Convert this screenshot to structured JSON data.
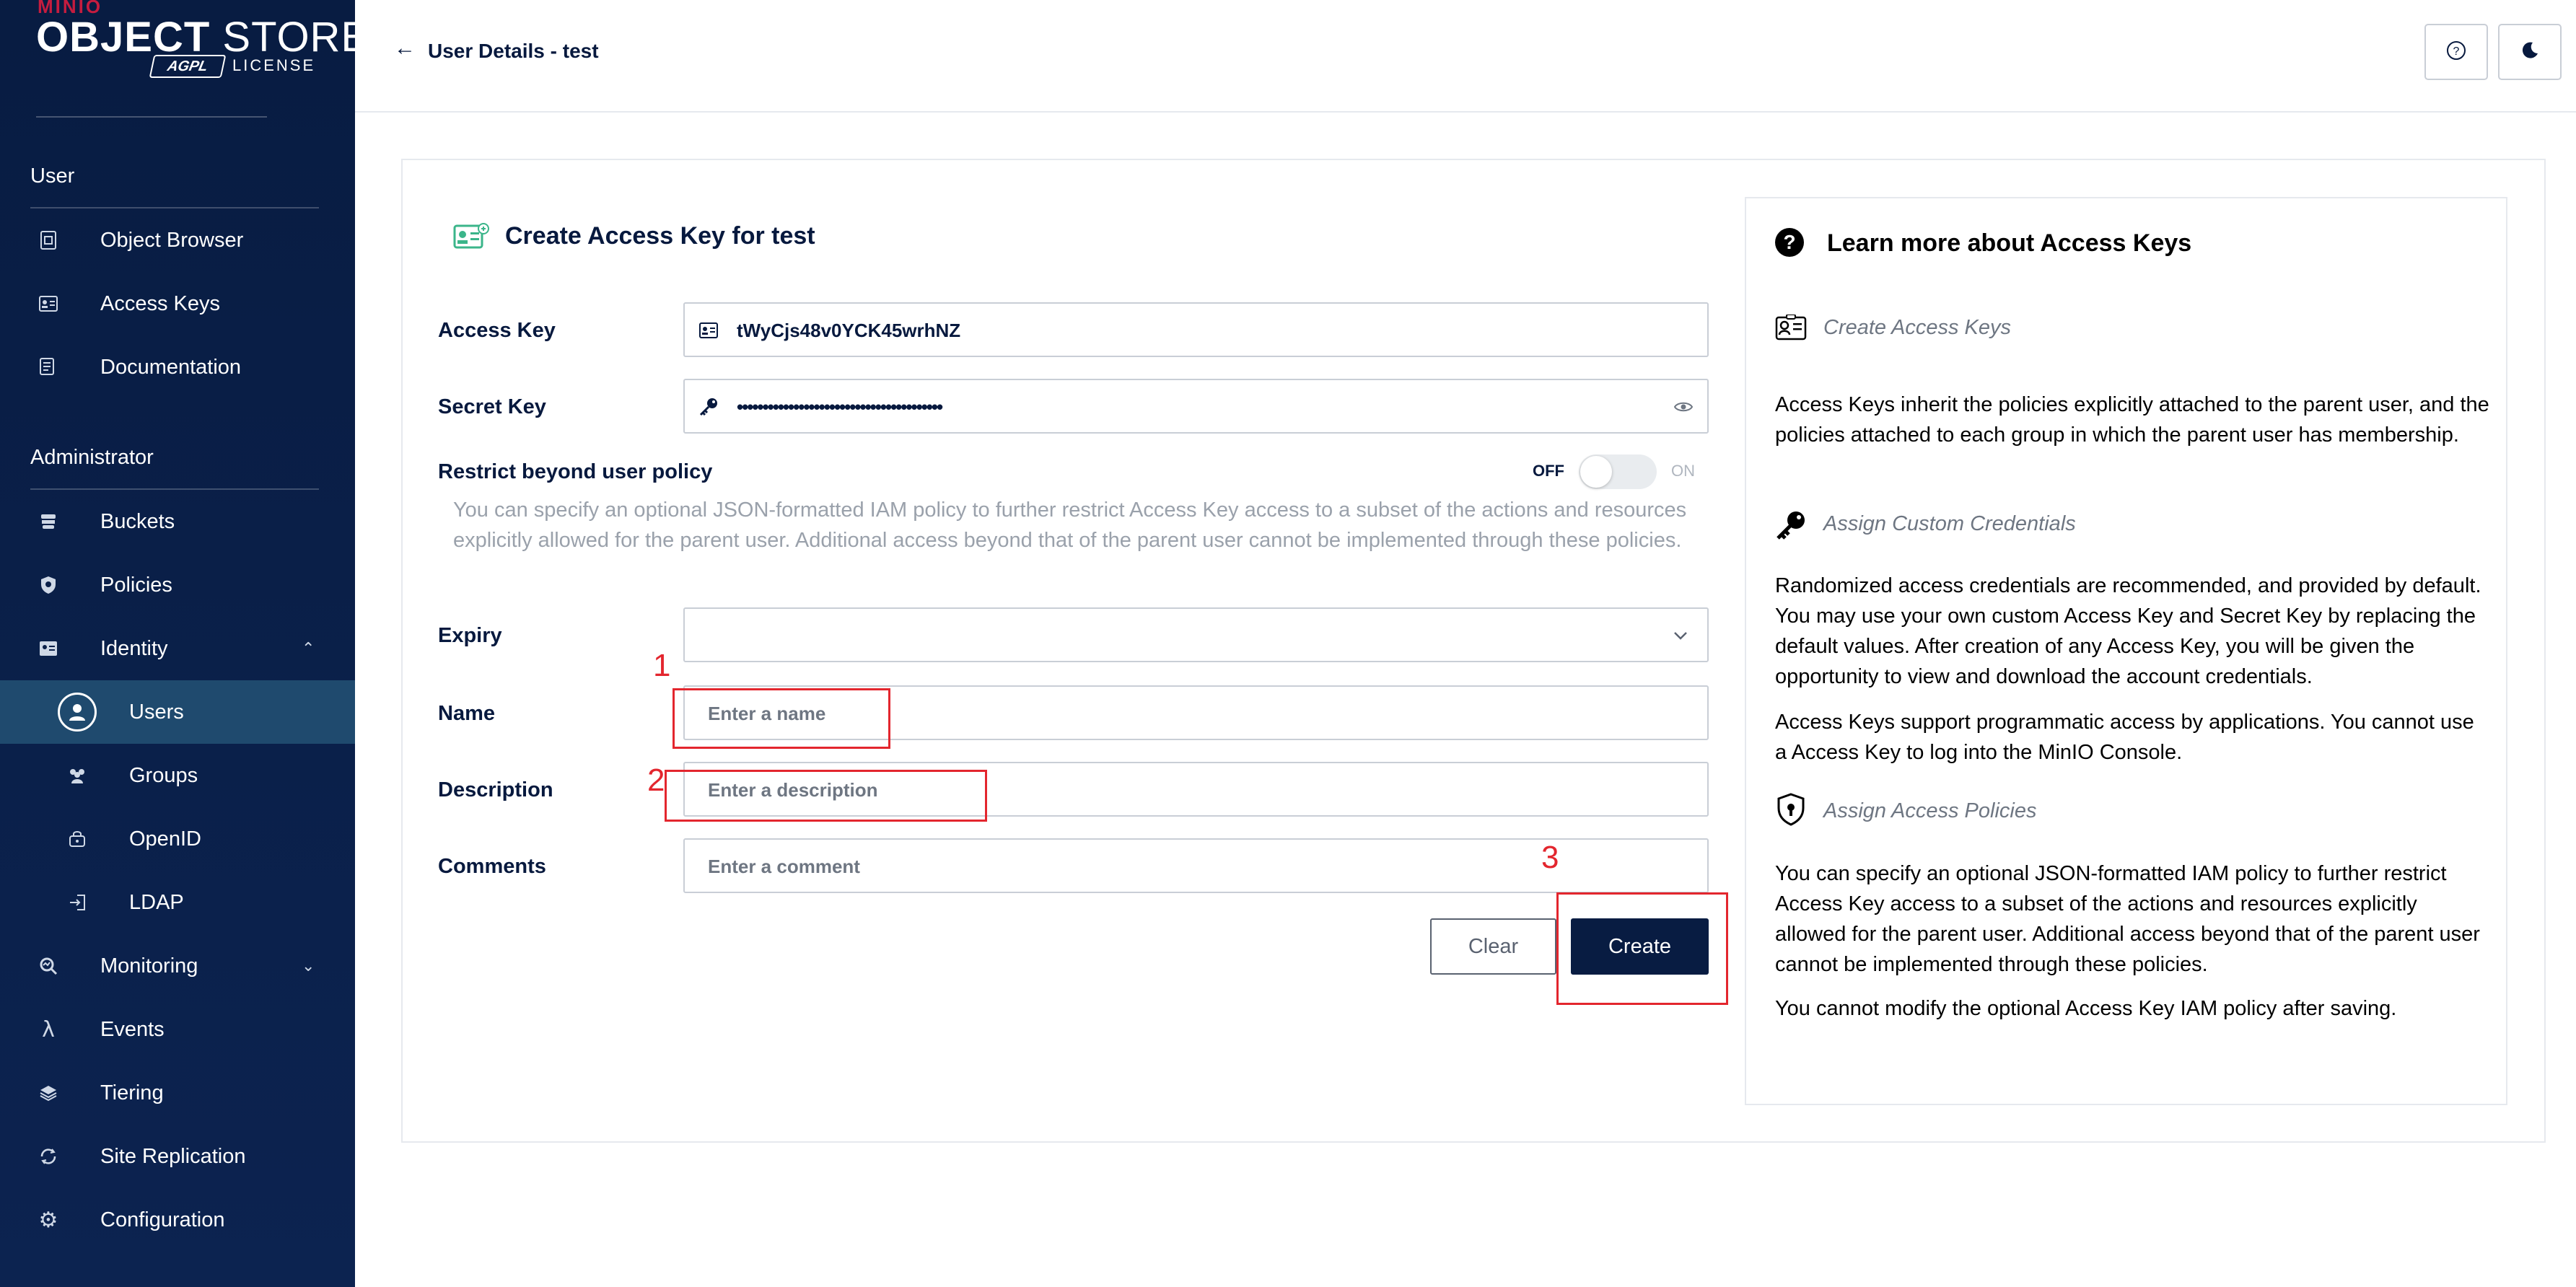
{
  "sidebar": {
    "logo": {
      "brand": "MINIO",
      "product_bold": "OBJECT",
      "product_light": " STORE",
      "badge": "AGPL",
      "license": "LICENSE"
    },
    "sections": {
      "user": {
        "title": "User",
        "items": [
          {
            "label": "Object Browser",
            "icon": "object-browser-icon"
          },
          {
            "label": "Access Keys",
            "icon": "access-keys-icon"
          },
          {
            "label": "Documentation",
            "icon": "documentation-icon"
          }
        ]
      },
      "admin": {
        "title": "Administrator",
        "items": [
          {
            "label": "Buckets",
            "icon": "buckets-icon"
          },
          {
            "label": "Policies",
            "icon": "policies-icon"
          },
          {
            "label": "Identity",
            "icon": "identity-icon",
            "expanded": true
          },
          {
            "label": "Users",
            "icon": "users-icon",
            "active": true
          },
          {
            "label": "Groups",
            "icon": "groups-icon"
          },
          {
            "label": "OpenID",
            "icon": "openid-icon"
          },
          {
            "label": "LDAP",
            "icon": "ldap-icon"
          },
          {
            "label": "Monitoring",
            "icon": "monitoring-icon",
            "expanded": false
          },
          {
            "label": "Events",
            "icon": "lambda-icon"
          },
          {
            "label": "Tiering",
            "icon": "tiering-icon"
          },
          {
            "label": "Site Replication",
            "icon": "site-replication-icon"
          },
          {
            "label": "Configuration",
            "icon": "gear-icon"
          }
        ]
      }
    }
  },
  "topbar": {
    "back_arrow": "←",
    "title": "User Details - test"
  },
  "form": {
    "title": "Create Access Key for test",
    "access_key": {
      "label": "Access Key",
      "value": "tWyCjs48v0YCK45wrhNZ"
    },
    "secret_key": {
      "label": "Secret Key",
      "value": "••••••••••••••••••••••••••••••••••••••••"
    },
    "restrict": {
      "label": "Restrict beyond user policy",
      "off": "OFF",
      "on": "ON",
      "enabled": false,
      "help": "You can specify an optional JSON-formatted IAM policy to further restrict Access Key access to a subset of the actions and resources explicitly allowed for the parent user. Additional access beyond that of the parent user cannot be implemented through these policies."
    },
    "expiry": {
      "label": "Expiry",
      "value": ""
    },
    "name": {
      "label": "Name",
      "placeholder": "Enter a name"
    },
    "description": {
      "label": "Description",
      "placeholder": "Enter a description"
    },
    "comments": {
      "label": "Comments",
      "placeholder": "Enter a comment"
    },
    "buttons": {
      "clear": "Clear",
      "create": "Create"
    }
  },
  "annotations": {
    "one": "1",
    "two": "2",
    "three": "3",
    "color": "#e3262e"
  },
  "help_panel": {
    "title": "Learn more about Access Keys",
    "sections": [
      {
        "subtitle": "Create Access Keys",
        "icon": "access-keys-icon",
        "paragraphs": [
          "Access Keys inherit the policies explicitly attached to the parent user, and the policies attached to each group in which the parent user has membership."
        ]
      },
      {
        "subtitle": "Assign Custom Credentials",
        "icon": "key-icon",
        "paragraphs": [
          "Randomized access credentials are recommended, and provided by default. You may use your own custom Access Key and Secret Key by replacing the default values. After creation of any Access Key, you will be given the opportunity to view and download the account credentials.",
          "Access Keys support programmatic access by applications. You cannot use a Access Key to log into the MinIO Console."
        ]
      },
      {
        "subtitle": "Assign Access Policies",
        "icon": "shield-icon",
        "paragraphs": [
          "You can specify an optional JSON-formatted IAM policy to further restrict Access Key access to a subset of the actions and resources explicitly allowed for the parent user. Additional access beyond that of the parent user cannot be implemented through these policies.",
          "You cannot modify the optional Access Key IAM policy after saving."
        ]
      }
    ]
  },
  "colors": {
    "sidebar_bg": "#081c42",
    "active_item": "#1f4a6e",
    "primary": "#081c42",
    "annotation": "#e3262e",
    "brand_red": "#c51c3f"
  }
}
